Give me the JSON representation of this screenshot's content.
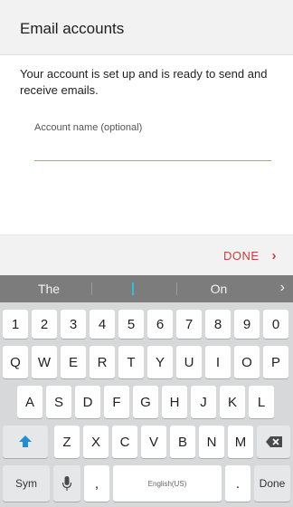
{
  "header": {
    "title": "Email accounts"
  },
  "content": {
    "message": "Your account is set up and is ready to send and receive emails.",
    "account_name_label": "Account name (optional)",
    "account_name_value": ""
  },
  "actions": {
    "done_label": "DONE"
  },
  "suggestions": {
    "left": "The",
    "right": "On"
  },
  "keyboard": {
    "number_row": [
      "1",
      "2",
      "3",
      "4",
      "5",
      "6",
      "7",
      "8",
      "9",
      "0"
    ],
    "row1": [
      "Q",
      "W",
      "E",
      "R",
      "T",
      "Y",
      "U",
      "I",
      "O",
      "P"
    ],
    "row2": [
      "A",
      "S",
      "D",
      "F",
      "G",
      "H",
      "J",
      "K",
      "L"
    ],
    "row3": [
      "Z",
      "X",
      "C",
      "V",
      "B",
      "N",
      "M"
    ],
    "sym_label": "Sym",
    "comma": ",",
    "space_label": "English(US)",
    "period": ".",
    "done_label": "Done"
  },
  "colors": {
    "accent": "#c4413e",
    "input_underline": "#e08a86",
    "shift_arrow": "#1e8fd6",
    "cursor": "#3ab8e0",
    "suggestion_bar": "#7c7c7c",
    "keyboard_bg": "#d6d8da"
  },
  "icons": {
    "shift": "shift-up-arrow-icon",
    "backspace": "backspace-icon",
    "mic": "microphone-icon",
    "next": "chevron-right-icon",
    "suggestion_more": "chevron-right-icon"
  }
}
